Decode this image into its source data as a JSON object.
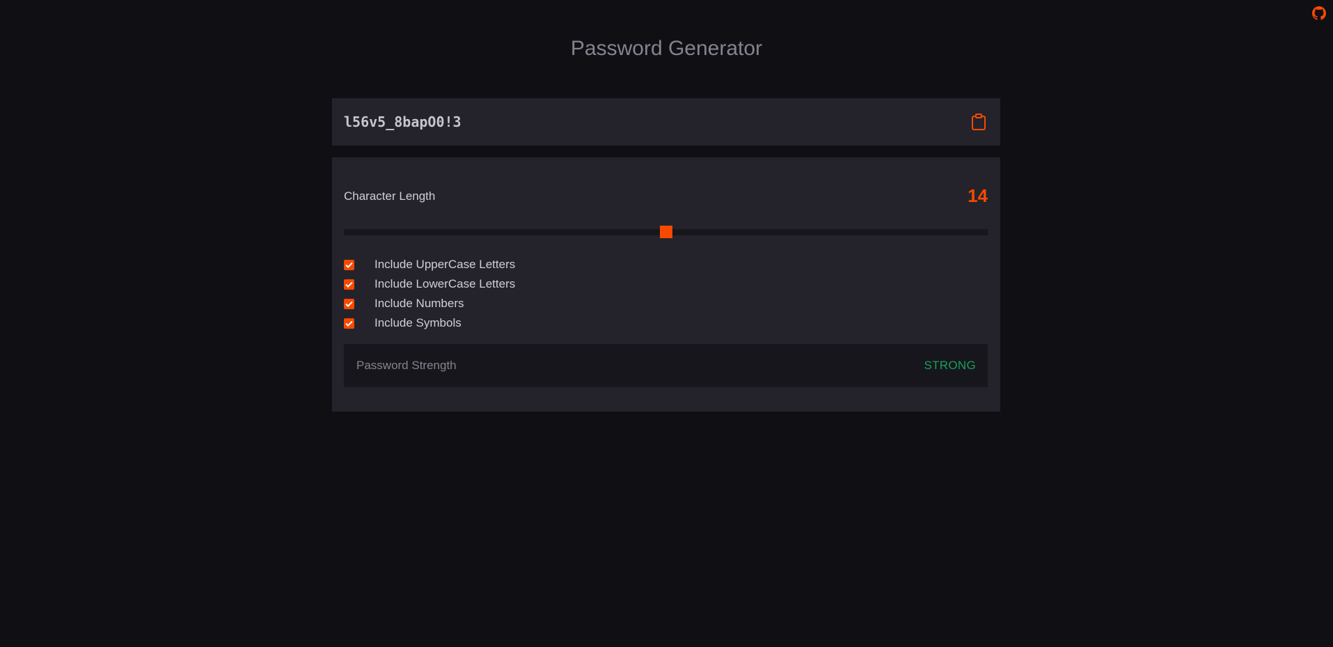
{
  "header": {
    "title": "Password Generator",
    "github_icon": "github-icon"
  },
  "password": {
    "value": "l56v5_8bapO0!3",
    "copy_icon": "clipboard-icon"
  },
  "length": {
    "label": "Character Length",
    "value": "14",
    "slider_level": 0.5
  },
  "options": [
    {
      "label": "Include UpperCase Letters",
      "checked": true
    },
    {
      "label": "Include LowerCase Letters",
      "checked": true
    },
    {
      "label": "Include Numbers",
      "checked": true
    },
    {
      "label": "Include Symbols",
      "checked": true
    }
  ],
  "strength": {
    "label": "Password Strength",
    "value": "STRONG"
  },
  "colors": {
    "background": "#0f0f14",
    "panel": "#24232b",
    "inset": "#17161d",
    "accent": "#f64a00",
    "strong": "#16a05a",
    "title": "#84838f",
    "text": "#d0cfd8"
  }
}
